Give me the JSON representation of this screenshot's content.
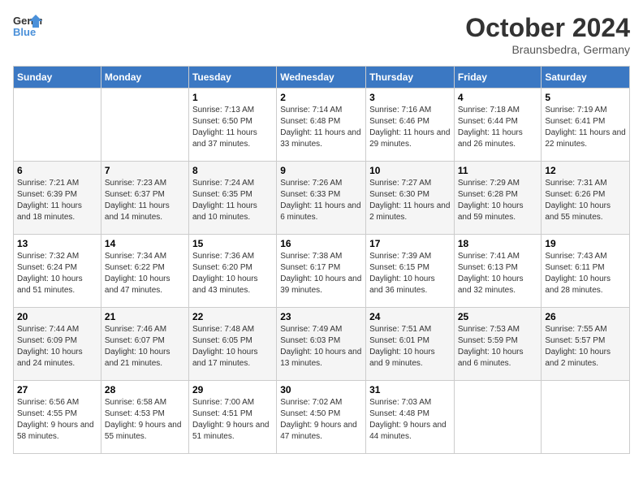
{
  "header": {
    "logo_general": "General",
    "logo_blue": "Blue",
    "month": "October 2024",
    "location": "Braunsbedra, Germany"
  },
  "weekdays": [
    "Sunday",
    "Monday",
    "Tuesday",
    "Wednesday",
    "Thursday",
    "Friday",
    "Saturday"
  ],
  "weeks": [
    [
      {
        "day": "",
        "info": ""
      },
      {
        "day": "",
        "info": ""
      },
      {
        "day": "1",
        "info": "Sunrise: 7:13 AM\nSunset: 6:50 PM\nDaylight: 11 hours and 37 minutes."
      },
      {
        "day": "2",
        "info": "Sunrise: 7:14 AM\nSunset: 6:48 PM\nDaylight: 11 hours and 33 minutes."
      },
      {
        "day": "3",
        "info": "Sunrise: 7:16 AM\nSunset: 6:46 PM\nDaylight: 11 hours and 29 minutes."
      },
      {
        "day": "4",
        "info": "Sunrise: 7:18 AM\nSunset: 6:44 PM\nDaylight: 11 hours and 26 minutes."
      },
      {
        "day": "5",
        "info": "Sunrise: 7:19 AM\nSunset: 6:41 PM\nDaylight: 11 hours and 22 minutes."
      }
    ],
    [
      {
        "day": "6",
        "info": "Sunrise: 7:21 AM\nSunset: 6:39 PM\nDaylight: 11 hours and 18 minutes."
      },
      {
        "day": "7",
        "info": "Sunrise: 7:23 AM\nSunset: 6:37 PM\nDaylight: 11 hours and 14 minutes."
      },
      {
        "day": "8",
        "info": "Sunrise: 7:24 AM\nSunset: 6:35 PM\nDaylight: 11 hours and 10 minutes."
      },
      {
        "day": "9",
        "info": "Sunrise: 7:26 AM\nSunset: 6:33 PM\nDaylight: 11 hours and 6 minutes."
      },
      {
        "day": "10",
        "info": "Sunrise: 7:27 AM\nSunset: 6:30 PM\nDaylight: 11 hours and 2 minutes."
      },
      {
        "day": "11",
        "info": "Sunrise: 7:29 AM\nSunset: 6:28 PM\nDaylight: 10 hours and 59 minutes."
      },
      {
        "day": "12",
        "info": "Sunrise: 7:31 AM\nSunset: 6:26 PM\nDaylight: 10 hours and 55 minutes."
      }
    ],
    [
      {
        "day": "13",
        "info": "Sunrise: 7:32 AM\nSunset: 6:24 PM\nDaylight: 10 hours and 51 minutes."
      },
      {
        "day": "14",
        "info": "Sunrise: 7:34 AM\nSunset: 6:22 PM\nDaylight: 10 hours and 47 minutes."
      },
      {
        "day": "15",
        "info": "Sunrise: 7:36 AM\nSunset: 6:20 PM\nDaylight: 10 hours and 43 minutes."
      },
      {
        "day": "16",
        "info": "Sunrise: 7:38 AM\nSunset: 6:17 PM\nDaylight: 10 hours and 39 minutes."
      },
      {
        "day": "17",
        "info": "Sunrise: 7:39 AM\nSunset: 6:15 PM\nDaylight: 10 hours and 36 minutes."
      },
      {
        "day": "18",
        "info": "Sunrise: 7:41 AM\nSunset: 6:13 PM\nDaylight: 10 hours and 32 minutes."
      },
      {
        "day": "19",
        "info": "Sunrise: 7:43 AM\nSunset: 6:11 PM\nDaylight: 10 hours and 28 minutes."
      }
    ],
    [
      {
        "day": "20",
        "info": "Sunrise: 7:44 AM\nSunset: 6:09 PM\nDaylight: 10 hours and 24 minutes."
      },
      {
        "day": "21",
        "info": "Sunrise: 7:46 AM\nSunset: 6:07 PM\nDaylight: 10 hours and 21 minutes."
      },
      {
        "day": "22",
        "info": "Sunrise: 7:48 AM\nSunset: 6:05 PM\nDaylight: 10 hours and 17 minutes."
      },
      {
        "day": "23",
        "info": "Sunrise: 7:49 AM\nSunset: 6:03 PM\nDaylight: 10 hours and 13 minutes."
      },
      {
        "day": "24",
        "info": "Sunrise: 7:51 AM\nSunset: 6:01 PM\nDaylight: 10 hours and 9 minutes."
      },
      {
        "day": "25",
        "info": "Sunrise: 7:53 AM\nSunset: 5:59 PM\nDaylight: 10 hours and 6 minutes."
      },
      {
        "day": "26",
        "info": "Sunrise: 7:55 AM\nSunset: 5:57 PM\nDaylight: 10 hours and 2 minutes."
      }
    ],
    [
      {
        "day": "27",
        "info": "Sunrise: 6:56 AM\nSunset: 4:55 PM\nDaylight: 9 hours and 58 minutes."
      },
      {
        "day": "28",
        "info": "Sunrise: 6:58 AM\nSunset: 4:53 PM\nDaylight: 9 hours and 55 minutes."
      },
      {
        "day": "29",
        "info": "Sunrise: 7:00 AM\nSunset: 4:51 PM\nDaylight: 9 hours and 51 minutes."
      },
      {
        "day": "30",
        "info": "Sunrise: 7:02 AM\nSunset: 4:50 PM\nDaylight: 9 hours and 47 minutes."
      },
      {
        "day": "31",
        "info": "Sunrise: 7:03 AM\nSunset: 4:48 PM\nDaylight: 9 hours and 44 minutes."
      },
      {
        "day": "",
        "info": ""
      },
      {
        "day": "",
        "info": ""
      }
    ]
  ]
}
